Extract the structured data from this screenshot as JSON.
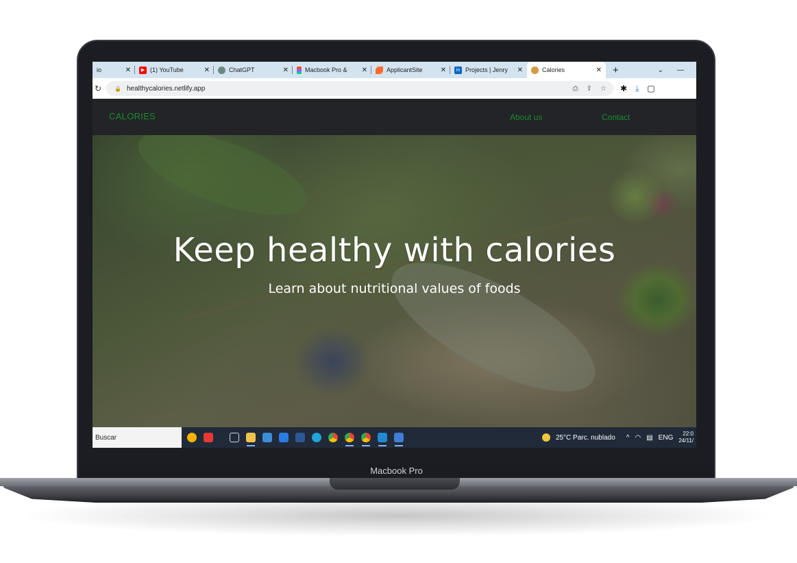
{
  "device_label": "Macbook Pro",
  "browser": {
    "tabs": [
      {
        "title": "io",
        "icon": "generic-tab-icon",
        "color": "#9aa0a6"
      },
      {
        "title": "(1) YouTube",
        "icon": "youtube-icon",
        "color": "#ff0000"
      },
      {
        "title": "ChatGPT",
        "icon": "chatgpt-icon",
        "color": "#10a37f"
      },
      {
        "title": "Macbook Pro &",
        "icon": "figma-icon",
        "color": "#f24e1e"
      },
      {
        "title": "ApplicantSite",
        "icon": "applicantsite-icon",
        "color": "#ff6a2b"
      },
      {
        "title": "Projects | Jenry",
        "icon": "linkedin-icon",
        "color": "#0a66c2"
      },
      {
        "title": "Calories",
        "icon": "calories-icon",
        "color": "#d59b3c"
      }
    ],
    "url": "healthycalories.netlify.app"
  },
  "site": {
    "brand": "CALORIES",
    "nav": {
      "about": "About us",
      "contact": "Contact"
    },
    "hero_title": "Keep healthy with calories",
    "hero_subtitle": "Learn about nutritional values of foods",
    "accent_color": "#1d8a2a"
  },
  "taskbar": {
    "search_placeholder": "Buscar",
    "weather": "25°C  Parc. nublado",
    "language": "ENG",
    "time": "22:0",
    "date": "24/11/"
  }
}
